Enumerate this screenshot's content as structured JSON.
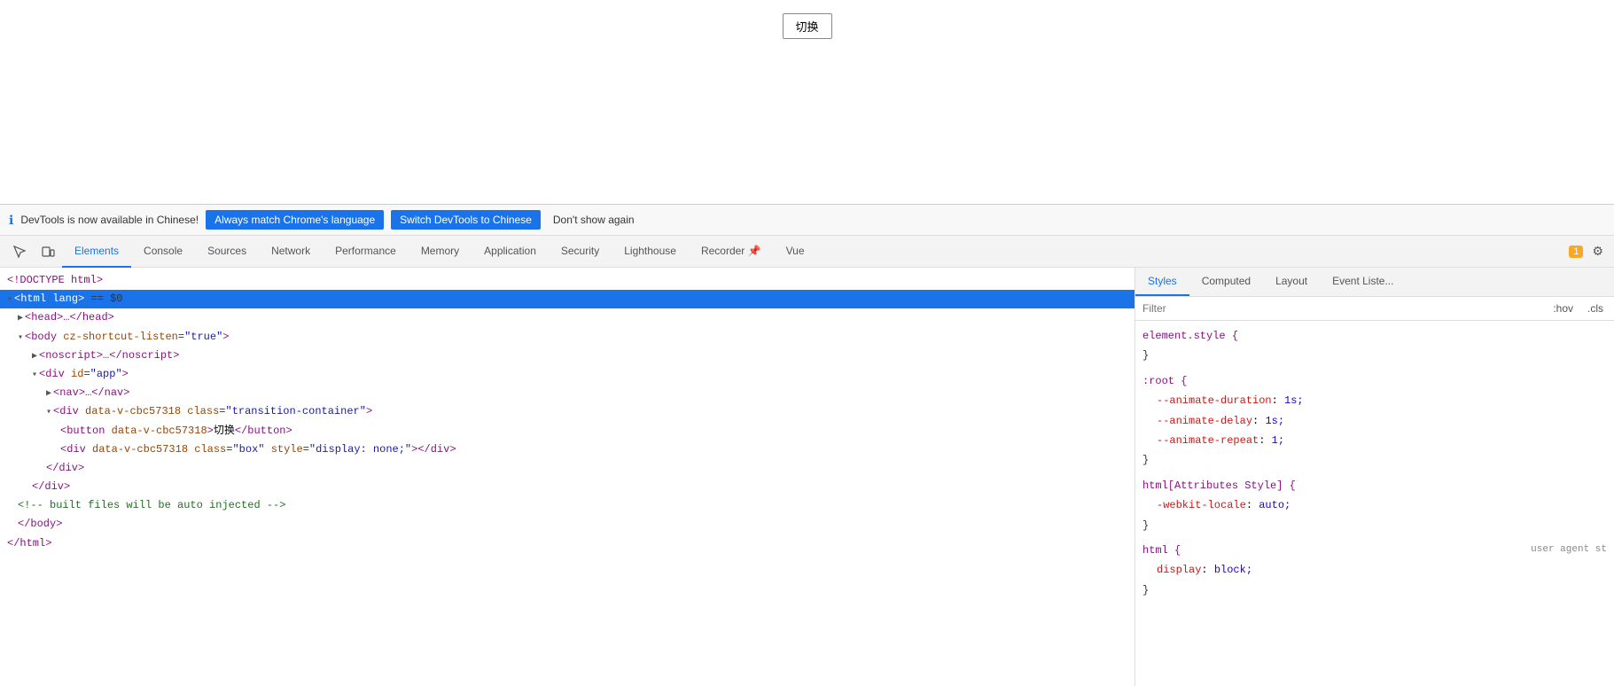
{
  "page": {
    "switch_button_label": "切换"
  },
  "notification": {
    "message": "DevTools is now available in Chinese!",
    "btn_always": "Always match Chrome's language",
    "btn_switch": "Switch DevTools to Chinese",
    "btn_dont_show": "Don't show again"
  },
  "devtools": {
    "tabs": [
      {
        "id": "elements",
        "label": "Elements",
        "active": true
      },
      {
        "id": "console",
        "label": "Console",
        "active": false
      },
      {
        "id": "sources",
        "label": "Sources",
        "active": false
      },
      {
        "id": "network",
        "label": "Network",
        "active": false
      },
      {
        "id": "performance",
        "label": "Performance",
        "active": false
      },
      {
        "id": "memory",
        "label": "Memory",
        "active": false
      },
      {
        "id": "application",
        "label": "Application",
        "active": false
      },
      {
        "id": "security",
        "label": "Security",
        "active": false
      },
      {
        "id": "lighthouse",
        "label": "Lighthouse",
        "active": false
      },
      {
        "id": "recorder",
        "label": "Recorder 📌",
        "active": false
      },
      {
        "id": "vue",
        "label": "Vue",
        "active": false
      }
    ],
    "notification_count": "1"
  },
  "elements": {
    "lines": [
      {
        "indent": 0,
        "content": "<!DOCTYPE html>",
        "type": "doctype"
      },
      {
        "indent": 0,
        "content": "<html lang>",
        "type": "tag-open",
        "selected": true,
        "extra": " == $0"
      },
      {
        "indent": 1,
        "content": "<head>…</head>",
        "type": "collapsed"
      },
      {
        "indent": 1,
        "content": "<body cz-shortcut-listen=\"true\">",
        "type": "tag-open"
      },
      {
        "indent": 2,
        "content": "<noscript>…</noscript>",
        "type": "collapsed"
      },
      {
        "indent": 2,
        "content": "<div id=\"app\">",
        "type": "tag-open"
      },
      {
        "indent": 3,
        "content": "<nav>…</nav>",
        "type": "collapsed"
      },
      {
        "indent": 3,
        "content": "<div data-v-cbc57318 class=\"transition-container\">",
        "type": "tag-open"
      },
      {
        "indent": 4,
        "content": "<button data-v-cbc57318>切换</button>",
        "type": "leaf"
      },
      {
        "indent": 4,
        "content": "<div data-v-cbc57318 class=\"box\" style=\"display: none;\"></div>",
        "type": "leaf"
      },
      {
        "indent": 3,
        "content": "</div>",
        "type": "tag-close"
      },
      {
        "indent": 2,
        "content": "</div>",
        "type": "tag-close"
      },
      {
        "indent": 1,
        "content": "<!-- built files will be auto injected -->",
        "type": "comment"
      },
      {
        "indent": 1,
        "content": "</body>",
        "type": "tag-close"
      },
      {
        "indent": 0,
        "content": "</html>",
        "type": "tag-close"
      }
    ]
  },
  "styles_panel": {
    "tabs": [
      {
        "id": "styles",
        "label": "Styles",
        "active": true
      },
      {
        "id": "computed",
        "label": "Computed",
        "active": false
      },
      {
        "id": "layout",
        "label": "Layout",
        "active": false
      },
      {
        "id": "event-listeners",
        "label": "Event Liste...",
        "active": false
      }
    ],
    "filter_placeholder": "Filter",
    "filter_hov": ":hov",
    "filter_cls": ".cls",
    "css_blocks": [
      {
        "selector": "element.style {",
        "properties": [],
        "close": "}"
      },
      {
        "selector": ":root {",
        "properties": [
          {
            "name": "--animate-duration",
            "value": "1s;"
          },
          {
            "name": "--animate-delay",
            "value": "1s;"
          },
          {
            "name": "--animate-repeat",
            "value": "1;"
          }
        ],
        "close": "}"
      },
      {
        "selector": "html[Attributes Style] {",
        "properties": [
          {
            "name": "-webkit-locale",
            "value": "auto;"
          }
        ],
        "close": "}"
      },
      {
        "selector": "html {",
        "source": "user agent st",
        "properties": [
          {
            "name": "display",
            "value": "block;"
          }
        ],
        "close": "}"
      }
    ]
  }
}
